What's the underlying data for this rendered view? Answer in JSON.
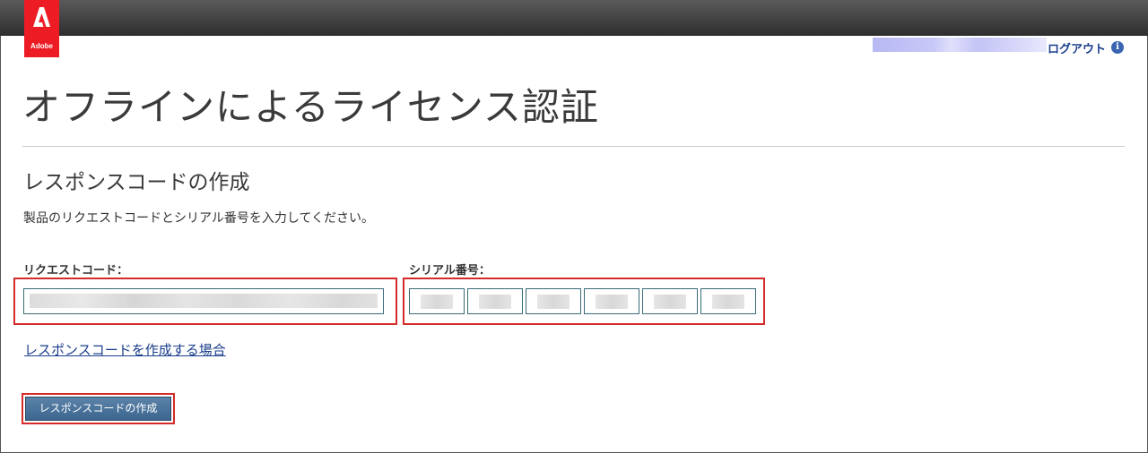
{
  "brand": {
    "logo_text": "Adobe",
    "color": "#ed1c24"
  },
  "header": {
    "logout_label": "ログアウト",
    "info_icon": "i"
  },
  "page": {
    "title": "オフラインによるライセンス認証",
    "section_title": "レスポンスコードの作成",
    "instructions": "製品のリクエストコードとシリアル番号を入力してください。"
  },
  "form": {
    "request_code_label": "リクエストコード：",
    "serial_label": "シリアル番号：",
    "serial_box_count": 6,
    "link_label": "レスポンスコードを作成する場合",
    "submit_label": "レスポンスコードの作成"
  },
  "colors": {
    "highlight": "#d42a2a",
    "link": "#1a3e8c",
    "button": "#3c6690"
  }
}
